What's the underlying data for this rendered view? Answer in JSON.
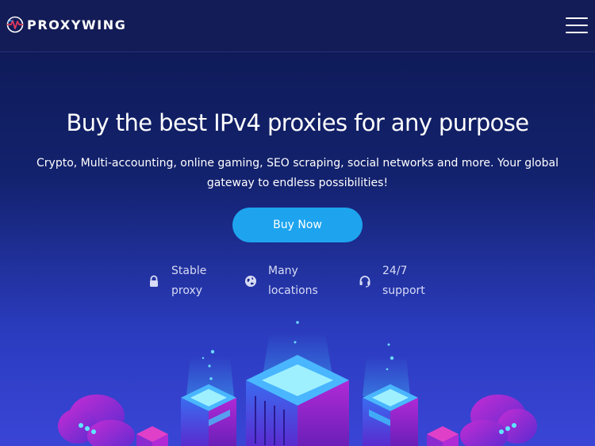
{
  "brand": {
    "name": "PROXYWING"
  },
  "navbar": {
    "menu_icon": "hamburger-menu-icon"
  },
  "hero": {
    "title": "Buy the best IPv4 proxies for any purpose",
    "subtitle": "Crypto, Multi-accounting, online gaming, SEO scraping, social networks and more. Your global gateway to endless possibilities!",
    "cta_label": "Buy Now"
  },
  "features": [
    {
      "icon": "lock-icon",
      "label": "Stable\nproxy"
    },
    {
      "icon": "globe-icon",
      "label": "Many\nlocations"
    },
    {
      "icon": "headset-icon",
      "label": "24/7\nsupport"
    }
  ],
  "colors": {
    "background_top": "#0d1850",
    "background_bottom": "#3a45d6",
    "navbar": "#141c57",
    "cta": "#1ea4ee",
    "feature_text": "#d7dbf5"
  }
}
